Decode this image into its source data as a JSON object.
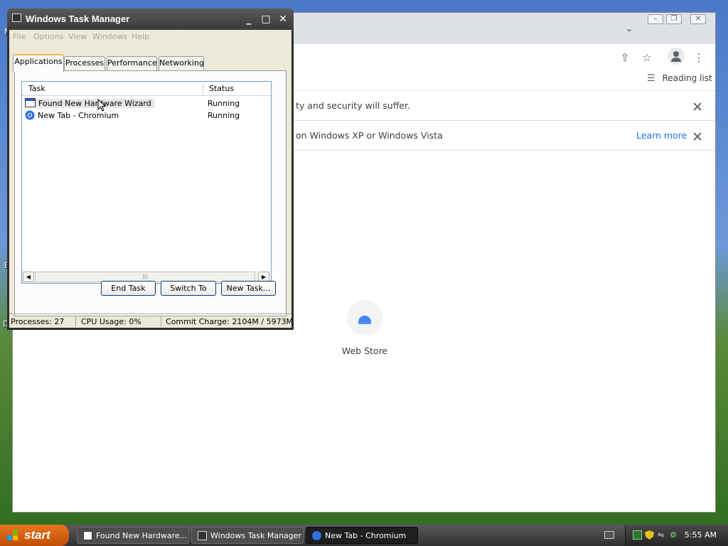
{
  "desktop": {
    "left_fragments": [
      "M",
      "E",
      "D"
    ]
  },
  "chromium": {
    "reading_list_label": "Reading list",
    "infobars": [
      {
        "message": "ty and security will suffer."
      },
      {
        "message": "on Windows XP or Windows Vista",
        "link": "Learn more"
      }
    ],
    "shortcut": {
      "label": "Web Store"
    }
  },
  "task_manager": {
    "title": "Windows Task Manager",
    "menu": [
      "File",
      "Options",
      "View",
      "Windows",
      "Help"
    ],
    "tabs": [
      "Applications",
      "Processes",
      "Performance",
      "Networking"
    ],
    "active_tab": "Applications",
    "columns": {
      "task": "Task",
      "status": "Status"
    },
    "rows": [
      {
        "task": "Found New Hardware Wizard",
        "status": "Running"
      },
      {
        "task": "New Tab - Chromium",
        "status": "Running"
      }
    ],
    "buttons": {
      "end_task": "End Task",
      "switch_to": "Switch To",
      "new_task": "New Task..."
    },
    "status_bar": {
      "processes": "Processes: 27",
      "cpu": "CPU Usage: 0%",
      "commit": "Commit Charge: 2104M / 5973M"
    }
  },
  "taskbar": {
    "start_label": "start",
    "tasks": [
      {
        "label": "Found New Hardware..."
      },
      {
        "label": "Windows Task Manager"
      },
      {
        "label": "New Tab - Chromium"
      }
    ],
    "clock": "5:55 AM"
  },
  "colors": {
    "xp_start": "#e8761e",
    "link_blue": "#1a73e8",
    "tab_highlight": "#f7b64c"
  }
}
